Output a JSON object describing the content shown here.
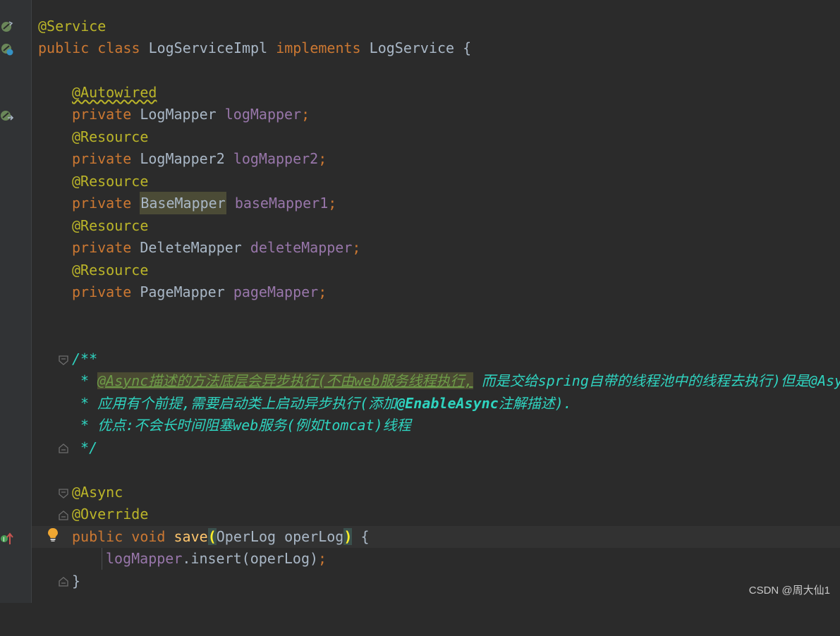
{
  "editor": {
    "l1": {
      "ann": "@Service"
    },
    "l2": {
      "kw1": "public",
      "kw2": "class",
      "name": "LogServiceImpl",
      "kw3": "implements",
      "iface": "LogService",
      "brace": "{"
    },
    "l4": {
      "ann": "@Autowired"
    },
    "l5": {
      "kw": "private",
      "type": "LogMapper",
      "field": "logMapper",
      "semi": ";"
    },
    "l6": {
      "ann": "@Resource"
    },
    "l7": {
      "kw": "private",
      "type": "LogMapper2",
      "field": "logMapper2",
      "semi": ";"
    },
    "l8": {
      "ann": "@Resource"
    },
    "l9": {
      "kw": "private",
      "type": "BaseMapper",
      "field": "baseMapper1",
      "semi": ";"
    },
    "l10": {
      "ann": "@Resource"
    },
    "l11": {
      "kw": "private",
      "type": "DeleteMapper",
      "field": "deleteMapper",
      "semi": ";"
    },
    "l12": {
      "ann": "@Resource"
    },
    "l13": {
      "kw": "private",
      "type": "PageMapper",
      "field": "pageMapper",
      "semi": ";"
    },
    "d1": "/**",
    "d2": {
      "star": " * ",
      "hl": "@Async描述的方法底层会异步执行(不由web服务线程执行,",
      "rest": " 而是交给spring自带的线程池中的线程去执行)但是@Async"
    },
    "d3": {
      "star": " * ",
      "t1": "应用有个前提,需要启动类上启动异步执行(添加",
      "ann": "@EnableAsync",
      "t2": "注解描述)."
    },
    "d4": {
      "star": " * ",
      "t1": "优点:不会长时间阻塞web服务(例如tomcat)线程"
    },
    "d5": " */",
    "m1": {
      "ann": "@Async"
    },
    "m2": {
      "ann": "@Override"
    },
    "m3": {
      "kw1": "public",
      "kw2": "void",
      "fn": "save",
      "open": "(",
      "params": "OperLog operLog",
      "close": ")",
      "brace": " {"
    },
    "m4": {
      "field": "logMapper",
      "rest": ".insert(operLog)",
      "semi": ";"
    },
    "m5": "}"
  },
  "watermark": "CSDN @周大仙1",
  "colors": {
    "background": "#2b2b2b",
    "keyword": "#cc7832",
    "annotation": "#bbb529",
    "field": "#9876aa",
    "javadoc": "#2fd4c0"
  },
  "icons": [
    "spring-bean-icon",
    "spring-bean-icon",
    "spring-autowire-icon",
    "fold-icon",
    "lightbulb-icon",
    "implements-method-icon"
  ]
}
